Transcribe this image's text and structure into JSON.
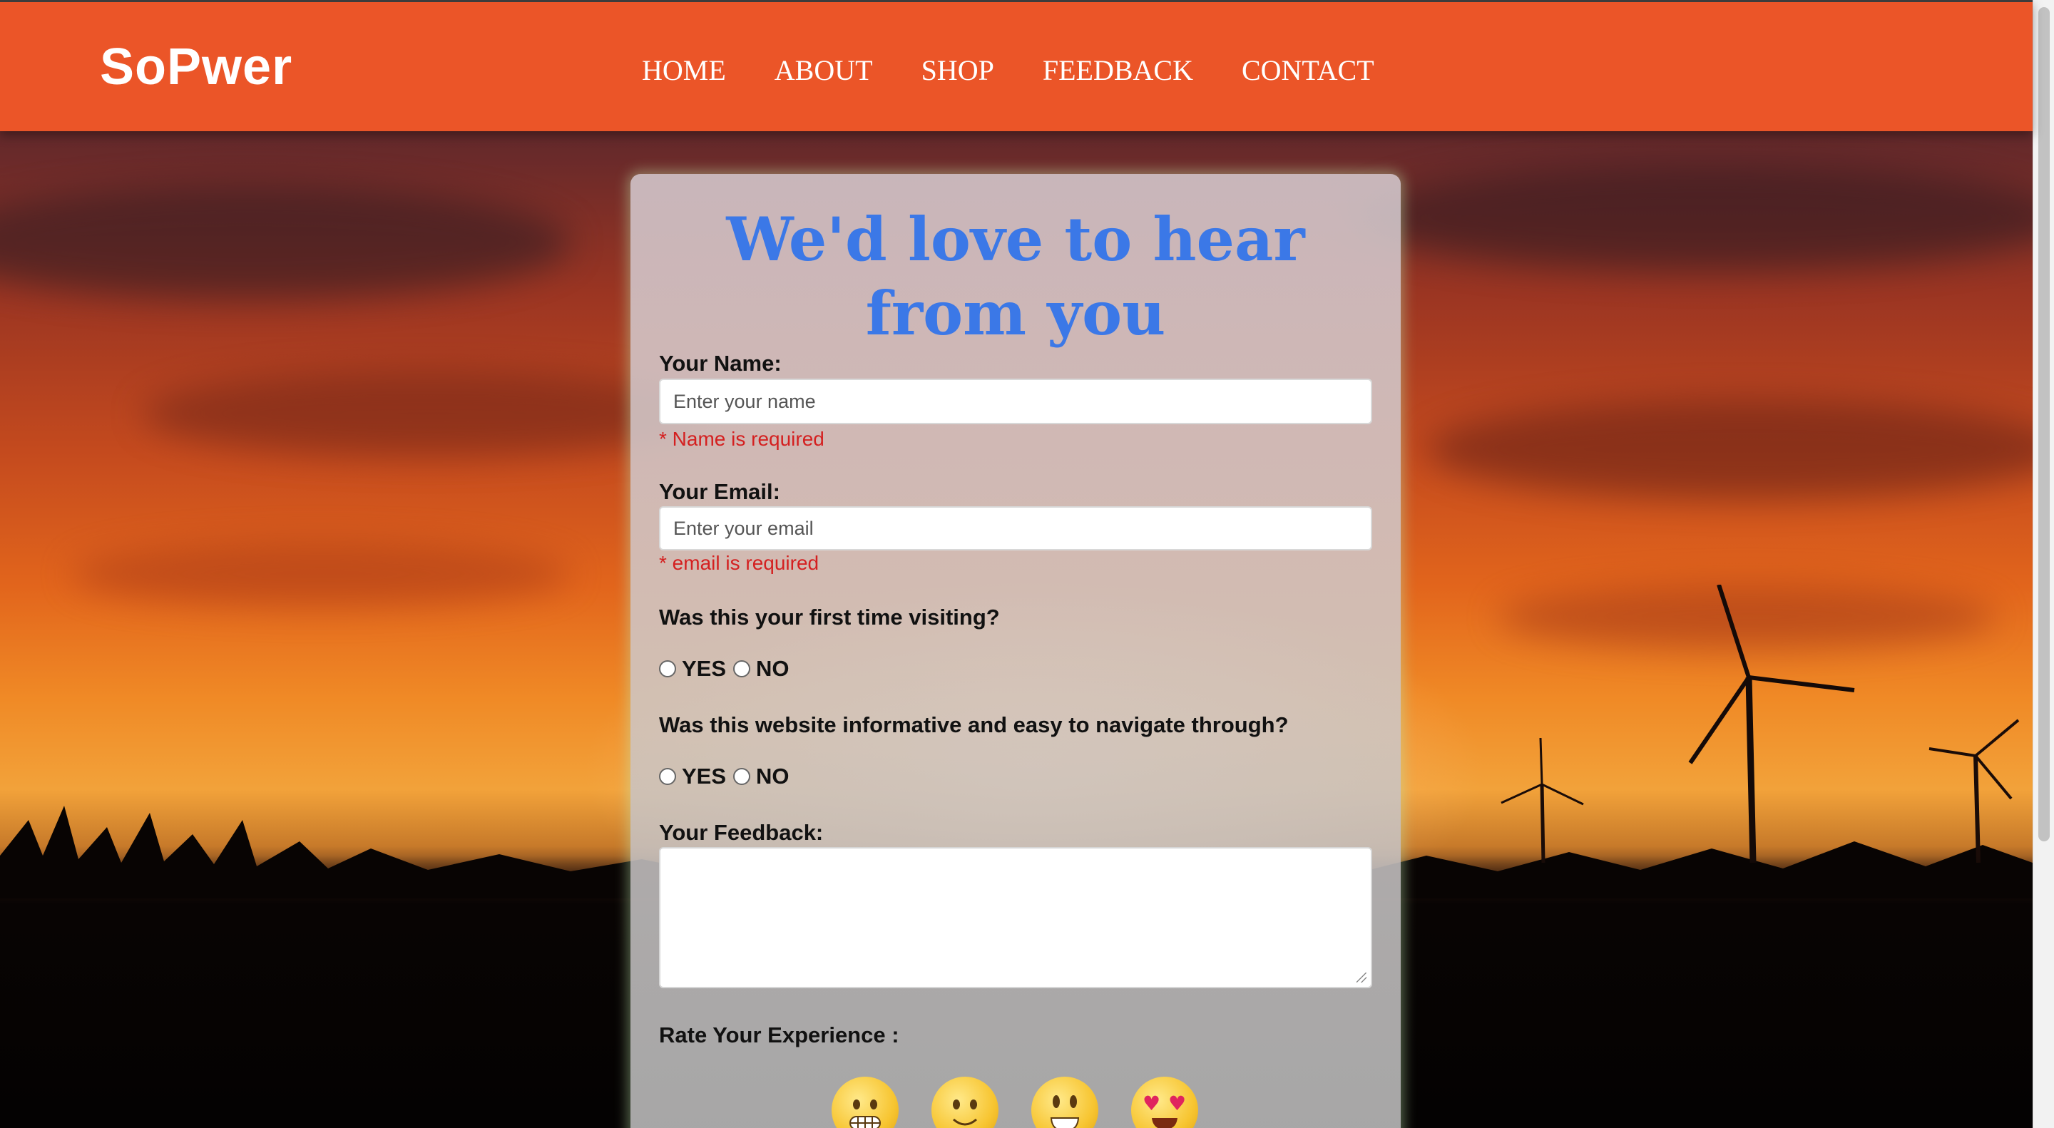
{
  "site": {
    "brand": "SoPwer",
    "nav": [
      "HOME",
      "ABOUT",
      "SHOP",
      "FEEDBACK",
      "CONTACT"
    ]
  },
  "form": {
    "title_line1": "We'd love to hear",
    "title_line2": "from you",
    "name": {
      "label": "Your Name:",
      "placeholder": "Enter your name",
      "value": "",
      "error": "* Name is required"
    },
    "email": {
      "label": "Your Email:",
      "placeholder": "Enter your email",
      "value": "",
      "error": "* email is required"
    },
    "q1": {
      "question": "Was this your first time visiting?",
      "yes": "YES",
      "no": "NO",
      "selected": null
    },
    "q2": {
      "question": "Was this website informative and easy to navigate through?",
      "yes": "YES",
      "no": "NO",
      "selected": null
    },
    "feedback": {
      "label": "Your Feedback:",
      "value": ""
    },
    "rating": {
      "label": "Rate Your Experience :",
      "options": [
        "grimacing-face",
        "slightly-smiling-face",
        "grinning-face",
        "heart-eyes-face"
      ],
      "selected": null
    }
  },
  "colors": {
    "navbar": "#eb5528",
    "title": "#3b78e7",
    "error": "#d42020"
  }
}
